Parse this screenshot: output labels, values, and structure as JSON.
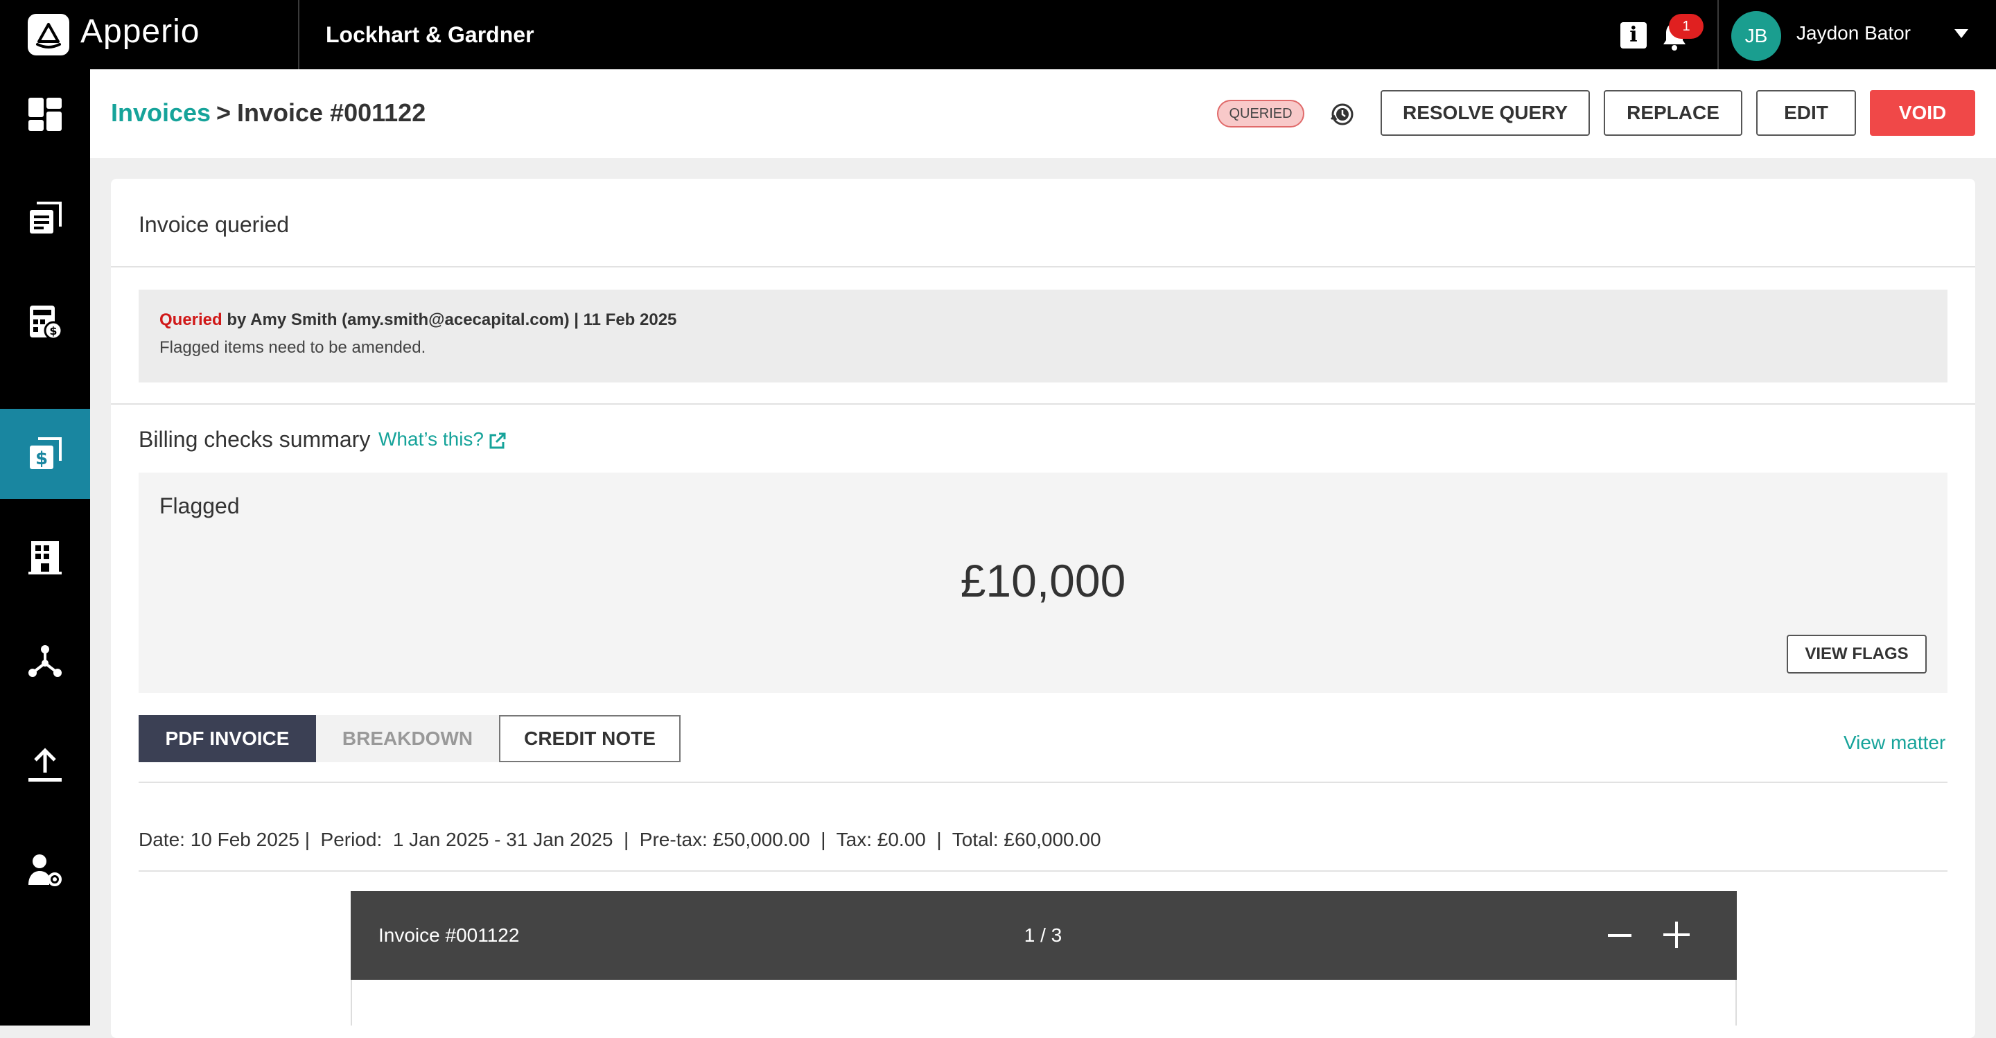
{
  "app": {
    "name": "Apperio",
    "organization": "Lockhart & Gardner"
  },
  "topbar": {
    "notification_count": "1",
    "user_initials": "JB",
    "user_name": "Jaydon Bator"
  },
  "sidebar": {
    "items": [
      {
        "name": "dashboard-icon"
      },
      {
        "name": "documents-icon"
      },
      {
        "name": "calculator-dollar-icon"
      },
      {
        "name": "invoices-icon",
        "active": true
      },
      {
        "name": "building-icon"
      },
      {
        "name": "network-icon"
      },
      {
        "name": "upload-icon"
      },
      {
        "name": "user-settings-icon"
      }
    ]
  },
  "breadcrumb": {
    "parent": "Invoices",
    "separator": ">",
    "current": "Invoice #001122"
  },
  "status": {
    "label": "QUERIED"
  },
  "actions": {
    "resolve": "RESOLVE QUERY",
    "replace": "REPLACE",
    "edit": "EDIT",
    "void": "VOID"
  },
  "card": {
    "title": "Invoice queried",
    "query": {
      "status_word": "Queried",
      "byline": " by Amy Smith (amy.smith@acecapital.com) | 11 Feb 2025",
      "message": "Flagged items need to be amended."
    },
    "billing_checks": {
      "title": "Billing checks summary",
      "help_link": "What’s this?",
      "flagged_label": "Flagged",
      "flagged_amount": "£10,000",
      "view_flags": "VIEW FLAGS"
    },
    "tabs": [
      {
        "label": "PDF INVOICE",
        "state": "active"
      },
      {
        "label": "BREAKDOWN",
        "state": "disabled"
      },
      {
        "label": "CREDIT NOTE",
        "state": "outline"
      }
    ],
    "view_matter": "View matter",
    "meta": "Date: 10 Feb 2025 |  Period:  1 Jan 2025 - 31 Jan 2025  |  Pre-tax: £50,000.00  |  Tax: £0.00  |  Total: £60,000.00",
    "pdf_viewer": {
      "title": "Invoice #001122",
      "page_indicator": "1 / 3"
    }
  },
  "colors": {
    "accent_teal": "#16a39a",
    "sidebar_active": "#1986a0",
    "void_red": "#f04848",
    "tab_active": "#3b4054"
  }
}
